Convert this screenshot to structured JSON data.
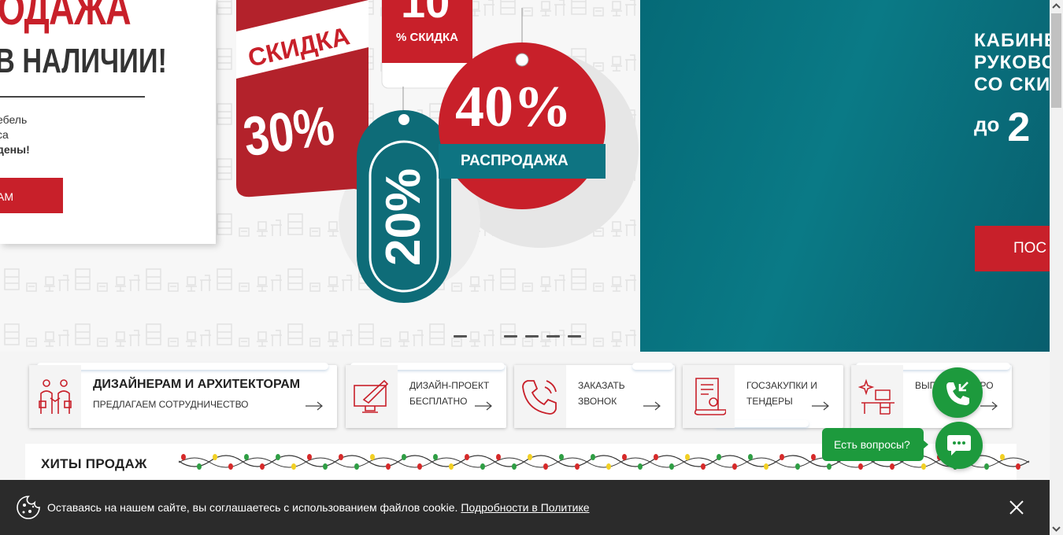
{
  "hero_left": {
    "title": "РОДАЖА",
    "subtitle": "В НАЛИЧИИ!",
    "text_line1": "ебель",
    "text_line2": "са",
    "text_line3": "дены!",
    "button_label": "АМ",
    "tag1_label": "СКИДКА",
    "tag1_value": "30%",
    "tag2_value": "10",
    "tag2_label": "% СКИДКА",
    "tag3_value": "40%",
    "tag3_label": "РАСПРОДАЖА",
    "tag4_value": "20%"
  },
  "hero_right": {
    "title": "КАБИНЕ\nРУКОВО\nСО СКИ",
    "prefix": "до",
    "number": "2",
    "button_label": "ПОС"
  },
  "features": [
    {
      "title": "ДИЗАЙНЕРАМ И АРХИТЕКТОРАМ",
      "subtitle": "ПРЕДЛАГАЕМ СОТРУДНИЧЕСТВО",
      "icon": "designers-icon"
    },
    {
      "text": "ДИЗАЙН-ПРОЕКТ БЕСПЛАТНО",
      "icon": "design-monitor-icon"
    },
    {
      "text": "ЗАКАЗАТЬ ЗВОНОК",
      "icon": "phone-icon"
    },
    {
      "text": "ГОСЗАКУПКИ И ТЕНДЕРЫ",
      "icon": "tender-document-icon"
    },
    {
      "text": "ВЫП        НЕ ПРО",
      "icon": "workplace-icon"
    }
  ],
  "hits": {
    "title": "ХИТЫ ПРОДАЖ"
  },
  "cookie": {
    "text": "Оставаясь на нашем сайте, вы соглашаетесь с использованием файлов cookie.",
    "link": "Подробности в Политике"
  },
  "chat": {
    "bubble": "Есть вопросы?"
  },
  "colors": {
    "brand_red": "#c8202a",
    "teal": "#0a7a86",
    "green": "#1d9a3d",
    "cookie_bg": "#2b2b2b"
  }
}
